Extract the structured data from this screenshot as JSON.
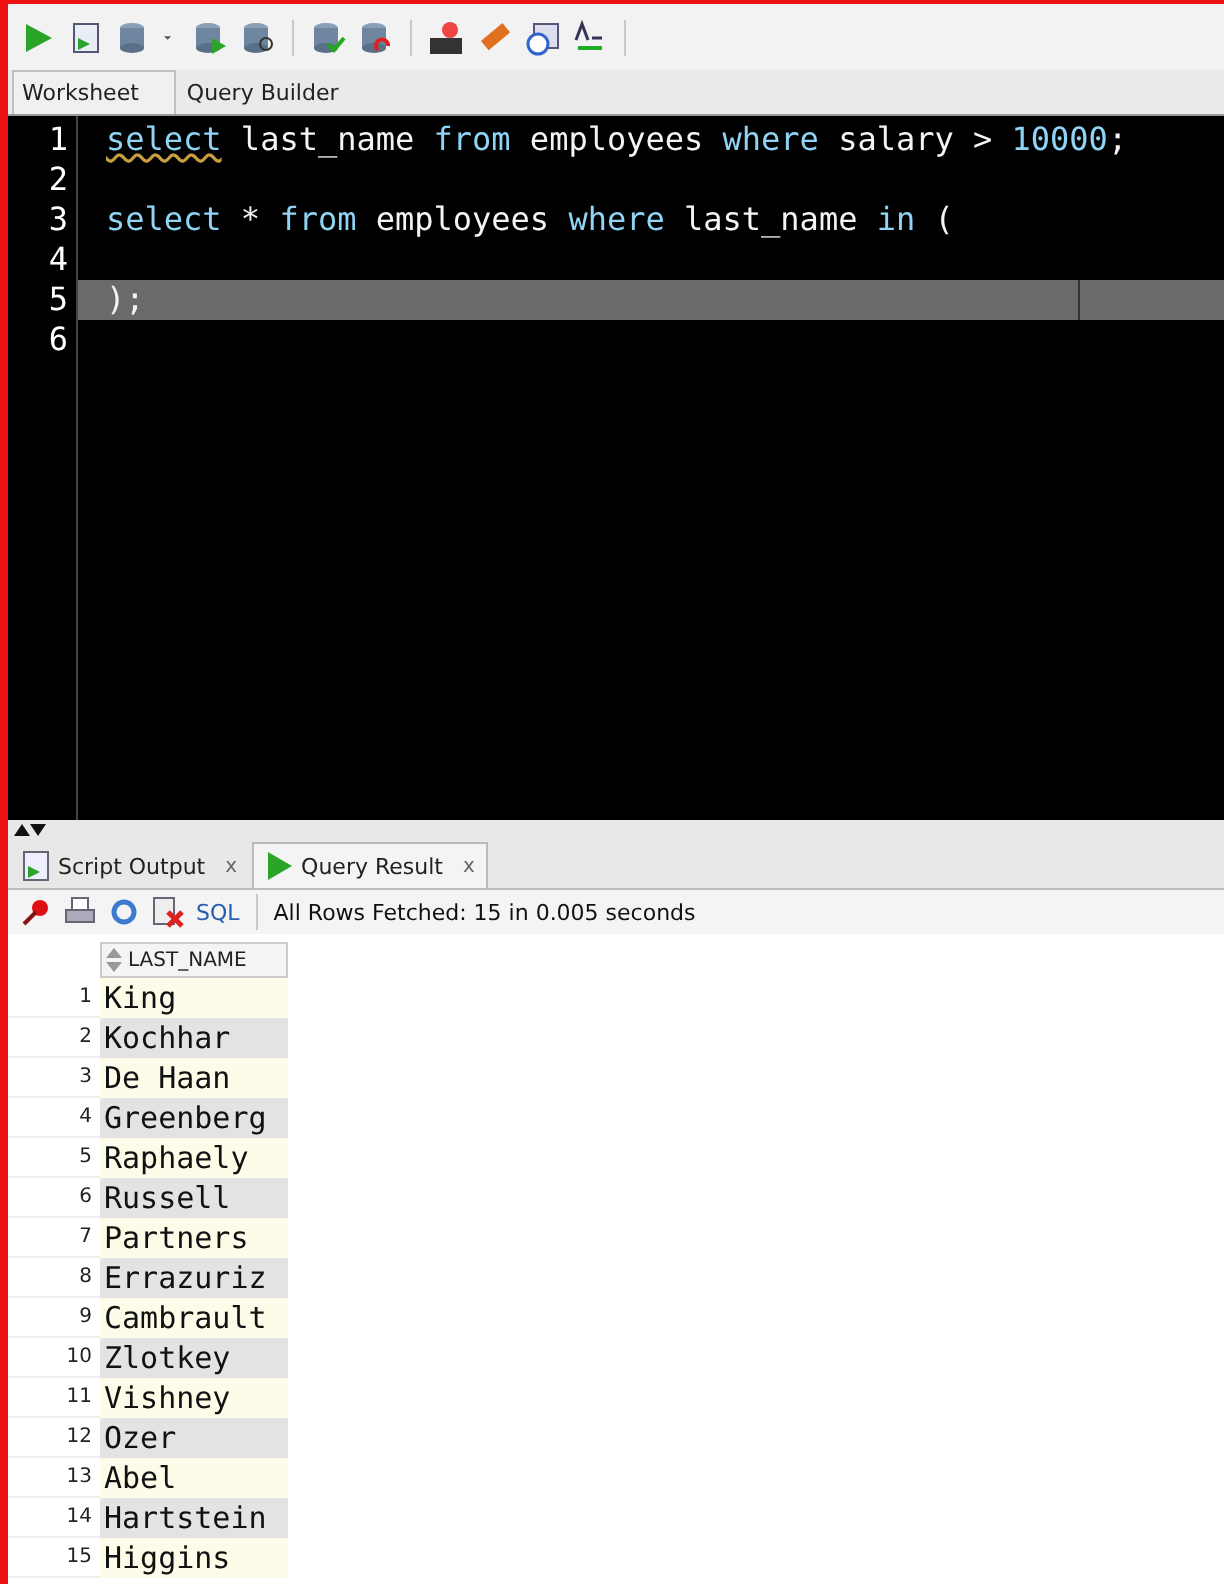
{
  "editor_tabs": [
    {
      "label": "Worksheet",
      "selected": true
    },
    {
      "label": "Query Builder",
      "selected": false
    }
  ],
  "editor": {
    "lines": [
      {
        "number": "1",
        "current": false,
        "tokens": [
          {
            "text": "select",
            "kind": "keyword",
            "squiggle": true
          },
          {
            "text": " last_name ",
            "kind": "plain"
          },
          {
            "text": "from",
            "kind": "keyword"
          },
          {
            "text": " employees ",
            "kind": "plain"
          },
          {
            "text": "where",
            "kind": "keyword"
          },
          {
            "text": " salary > ",
            "kind": "plain"
          },
          {
            "text": "10000",
            "kind": "keyword"
          },
          {
            "text": ";",
            "kind": "plain"
          }
        ]
      },
      {
        "number": "2",
        "current": false
      },
      {
        "number": "3",
        "current": false,
        "tokens": [
          {
            "text": "select",
            "kind": "keyword"
          },
          {
            "text": " * ",
            "kind": "plain"
          },
          {
            "text": "from",
            "kind": "keyword"
          },
          {
            "text": " employees ",
            "kind": "plain"
          },
          {
            "text": "where",
            "kind": "keyword"
          },
          {
            "text": " last_name ",
            "kind": "plain"
          },
          {
            "text": "in",
            "kind": "keyword"
          },
          {
            "text": " (",
            "kind": "plain"
          }
        ]
      },
      {
        "number": "4",
        "current": false
      },
      {
        "number": "5",
        "current": true,
        "tokens": [
          {
            "text": ");",
            "kind": "plain"
          }
        ]
      },
      {
        "number": "6",
        "current": false
      }
    ]
  },
  "result_tabs": [
    {
      "label": "Script Output",
      "close": "x",
      "selected": false
    },
    {
      "label": "Query Result",
      "close": "x",
      "selected": true
    }
  ],
  "result_toolbar": {
    "sql_link": "SQL",
    "status": "All Rows Fetched: 15 in 0.005 seconds"
  },
  "grid": {
    "column": "LAST_NAME",
    "rows": [
      {
        "number": "1",
        "value": "King"
      },
      {
        "number": "2",
        "value": "Kochhar"
      },
      {
        "number": "3",
        "value": "De Haan"
      },
      {
        "number": "4",
        "value": "Greenberg"
      },
      {
        "number": "5",
        "value": "Raphaely"
      },
      {
        "number": "6",
        "value": "Russell"
      },
      {
        "number": "7",
        "value": "Partners"
      },
      {
        "number": "8",
        "value": "Errazuriz"
      },
      {
        "number": "9",
        "value": "Cambrault"
      },
      {
        "number": "10",
        "value": "Zlotkey"
      },
      {
        "number": "11",
        "value": "Vishney"
      },
      {
        "number": "12",
        "value": "Ozer"
      },
      {
        "number": "13",
        "value": "Abel"
      },
      {
        "number": "14",
        "value": "Hartstein"
      },
      {
        "number": "15",
        "value": "Higgins"
      }
    ]
  }
}
